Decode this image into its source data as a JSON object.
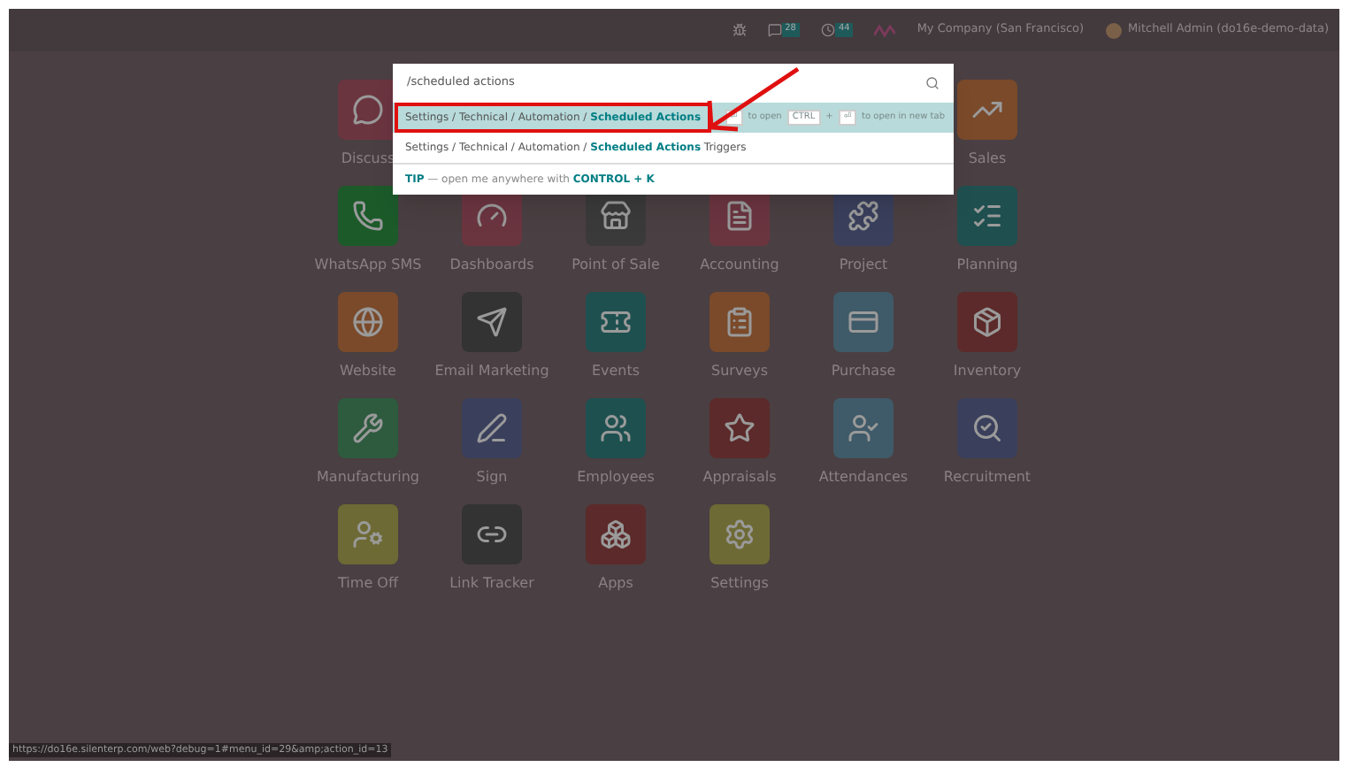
{
  "top_bar": {
    "messages_badge": "28",
    "activities_badge": "44",
    "company": "My Company (San Francisco)",
    "user": "Mitchell Admin (do16e-demo-data)"
  },
  "command_palette": {
    "query": "/scheduled actions",
    "results": [
      {
        "text": "Settings / Technical / Automation / **Scheduled Actions**",
        "selected": true
      },
      {
        "text": "Settings / Technical / Automation / **Scheduled Actions** Triggers",
        "selected": false
      }
    ],
    "hints": [
      {
        "kind": "key",
        "text": "⏎"
      },
      {
        "kind": "text",
        "text": "to open"
      },
      {
        "kind": "key",
        "text": "CTRL"
      },
      {
        "kind": "text",
        "text": "+"
      },
      {
        "kind": "key",
        "text": "⏎"
      },
      {
        "kind": "text",
        "text": "to open in new tab"
      }
    ],
    "tip": "**TIP** — open me anywhere with **CONTROL + K**"
  },
  "first_row": [
    {
      "label": "Discuss",
      "color": "#6b3540"
    },
    {
      "label": "Sales",
      "color": "#7a4a2a"
    }
  ],
  "apps": [
    {
      "label": "WhatsApp SMS",
      "color": "#1c5a2a"
    },
    {
      "label": "Dashboards",
      "color": "#6b3540"
    },
    {
      "label": "Point of Sale",
      "color": "#3a3a3a"
    },
    {
      "label": "Accounting",
      "color": "#6b3540"
    },
    {
      "label": "Project",
      "color": "#3a3f5c"
    },
    {
      "label": "Planning",
      "color": "#1f4f4f"
    },
    {
      "label": "Website",
      "color": "#7a4a2a"
    },
    {
      "label": "Email Marketing",
      "color": "#333333"
    },
    {
      "label": "Events",
      "color": "#1f5050"
    },
    {
      "label": "Surveys",
      "color": "#7a4a2a"
    },
    {
      "label": "Purchase",
      "color": "#3f5a68"
    },
    {
      "label": "Inventory",
      "color": "#5c2a2a"
    },
    {
      "label": "Manufacturing",
      "color": "#2e5a3e"
    },
    {
      "label": "Sign",
      "color": "#3a3f5c"
    },
    {
      "label": "Employees",
      "color": "#1f5050"
    },
    {
      "label": "Appraisals",
      "color": "#5c2a2a"
    },
    {
      "label": "Attendances",
      "color": "#3f5a68"
    },
    {
      "label": "Recruitment",
      "color": "#3a3f5c"
    },
    {
      "label": "Time Off",
      "color": "#6e6a35"
    },
    {
      "label": "Link Tracker",
      "color": "#333333"
    },
    {
      "label": "Apps",
      "color": "#5c2a2a"
    },
    {
      "label": "Settings",
      "color": "#6e6a35"
    }
  ],
  "status_url": "https://do16e.silenterp.com/web?debug=1#menu_id=29&amp;action_id=13"
}
